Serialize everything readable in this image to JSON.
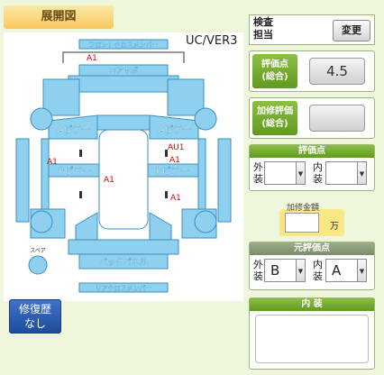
{
  "diagram": {
    "tab_label": "展開図",
    "version": "UC/VER3",
    "parts": {
      "front_cross_member": "フロントクロスメンバー",
      "core_support": "コアサポ",
      "a_pillar_left": "Aピラー",
      "a_pillar_right": "Aピラー",
      "b_pillar_left": "Bピラー",
      "b_pillar_right": "Bピラー",
      "back_panel": "バックパネル",
      "rear_cross_member": "リアクロスメンバー",
      "spare": "スペア"
    },
    "marks": {
      "front": "A1",
      "left_side": "A1",
      "center": "A1",
      "right_upper": "AU1",
      "right_side": "A1",
      "right_lower": "A1"
    }
  },
  "history": {
    "line1": "修復歴",
    "line2": "なし"
  },
  "inspector": {
    "label_line1": "検査",
    "label_line2": "担当",
    "change_button": "変更"
  },
  "overall_score": {
    "label_line1": "評価点",
    "label_line2": "(総合)",
    "value": "4.5"
  },
  "repair_score": {
    "label_line1": "加修評価",
    "label_line2": "(総合)",
    "value": ""
  },
  "grade": {
    "title": "評価点",
    "exterior_label_1": "外",
    "exterior_label_2": "装",
    "exterior_value": "",
    "interior_label_1": "内",
    "interior_label_2": "装",
    "interior_value": ""
  },
  "repair_amount": {
    "label": "加修金額",
    "value": "",
    "unit": "万"
  },
  "original_grade": {
    "title": "元評価点",
    "exterior_label_1": "外",
    "exterior_label_2": "装",
    "exterior_value": "B",
    "interior_label_1": "内",
    "interior_label_2": "装",
    "interior_value": "A"
  },
  "interior_notes": {
    "title": "内 装",
    "value": ""
  }
}
